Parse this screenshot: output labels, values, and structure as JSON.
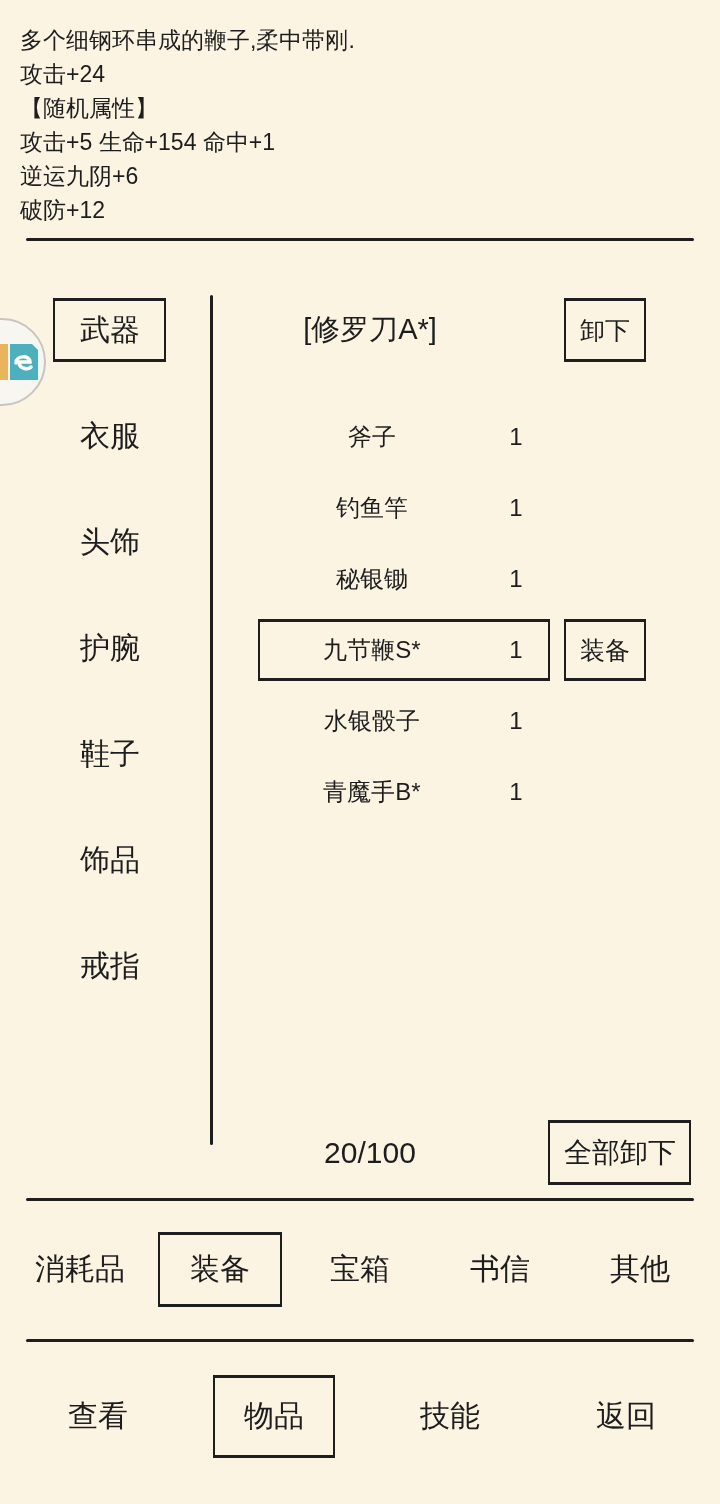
{
  "description": {
    "lines": [
      "多个细钢环串成的鞭子,柔中带刚.",
      "攻击+24",
      "【随机属性】",
      "攻击+5 生命+154 命中+1",
      "逆运九阴+6",
      "破防+12"
    ]
  },
  "categories": [
    {
      "label": "武器",
      "selected": true
    },
    {
      "label": "衣服",
      "selected": false
    },
    {
      "label": "头饰",
      "selected": false
    },
    {
      "label": "护腕",
      "selected": false
    },
    {
      "label": "鞋子",
      "selected": false
    },
    {
      "label": "饰品",
      "selected": false
    },
    {
      "label": "戒指",
      "selected": false
    }
  ],
  "equipped": {
    "name": "[修罗刀A*]",
    "button": "卸下"
  },
  "items": [
    {
      "name": "斧子",
      "count": "1",
      "selected": false
    },
    {
      "name": "钓鱼竿",
      "count": "1",
      "selected": false
    },
    {
      "name": "秘银锄",
      "count": "1",
      "selected": false
    },
    {
      "name": "九节鞭S*",
      "count": "1",
      "selected": true
    },
    {
      "name": "水银骰子",
      "count": "1",
      "selected": false
    },
    {
      "name": "青魔手B*",
      "count": "1",
      "selected": false
    }
  ],
  "item_action_button": "装备",
  "capacity": "20/100",
  "unequip_all_button": "全部卸下",
  "item_tabs": [
    {
      "label": "消耗品",
      "selected": false
    },
    {
      "label": "装备",
      "selected": true
    },
    {
      "label": "宝箱",
      "selected": false
    },
    {
      "label": "书信",
      "selected": false
    },
    {
      "label": "其他",
      "selected": false
    }
  ],
  "nav": [
    {
      "label": "查看",
      "selected": false
    },
    {
      "label": "物品",
      "selected": true
    },
    {
      "label": "技能",
      "selected": false
    },
    {
      "label": "返回",
      "selected": false
    }
  ]
}
